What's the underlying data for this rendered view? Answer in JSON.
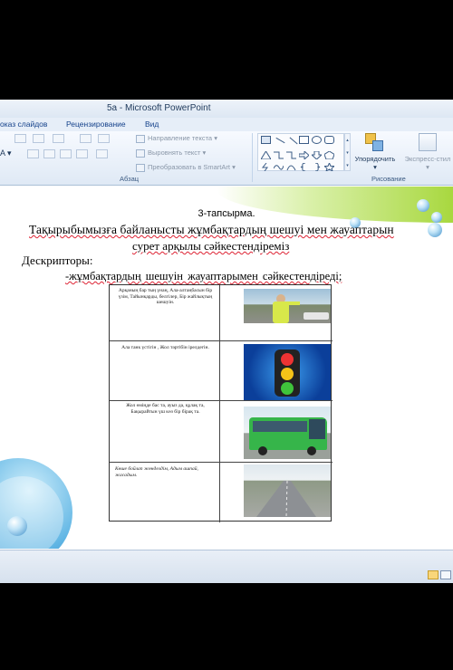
{
  "window": {
    "title": "5а  -  Microsoft PowerPoint"
  },
  "ribbon_tabs": [
    "оказ слайдов",
    "Рецензирование",
    "Вид"
  ],
  "ribbon": {
    "paragraph": {
      "label": "Абзац",
      "text_direction": "Направление текста",
      "align_text": "Выровнять текст",
      "convert_smartart": "Преобразовать в SmartArt"
    },
    "drawing": {
      "label": "Рисование",
      "arrange": "Упорядочить",
      "quick_styles": "Экспресс-стил"
    }
  },
  "slide": {
    "task_title": "3-тапсырма.",
    "line1": "Тақырыбымызға байланысты жұмбақтардың шешуі мен жауаптарын",
    "line2": "сурет арқылы сәйкестендіреміз",
    "descriptors_label": "Дескрипторы:",
    "descriptor1": "-жұмбақтардың шешуін жауаптарымен сәйкестендіреді;",
    "rows": [
      {
        "riddle": "Арқаның бар тың үнаң, Ала-алтаңбасын бір үзім, Тайынқарды, белгілер, Бір жайлықтың шешуін.",
        "image": "traffic-police"
      },
      {
        "riddle": "Ала танк үстігін , Жол тәртібін ірелдегін.",
        "image": "traffic-light"
      },
      {
        "riddle": "Жол өміңде бас та, ауыз да, құлақ та, Бақырайтын үш көз бір бірақ та.",
        "image": "green-bus"
      },
      {
        "riddle": "Көше бойлап жөнделдім, Адым ашпай, жасадым.",
        "image": "highway"
      }
    ]
  },
  "colors": {
    "accent_green": "#a8d83f",
    "accent_blue": "#3f8fc9"
  }
}
